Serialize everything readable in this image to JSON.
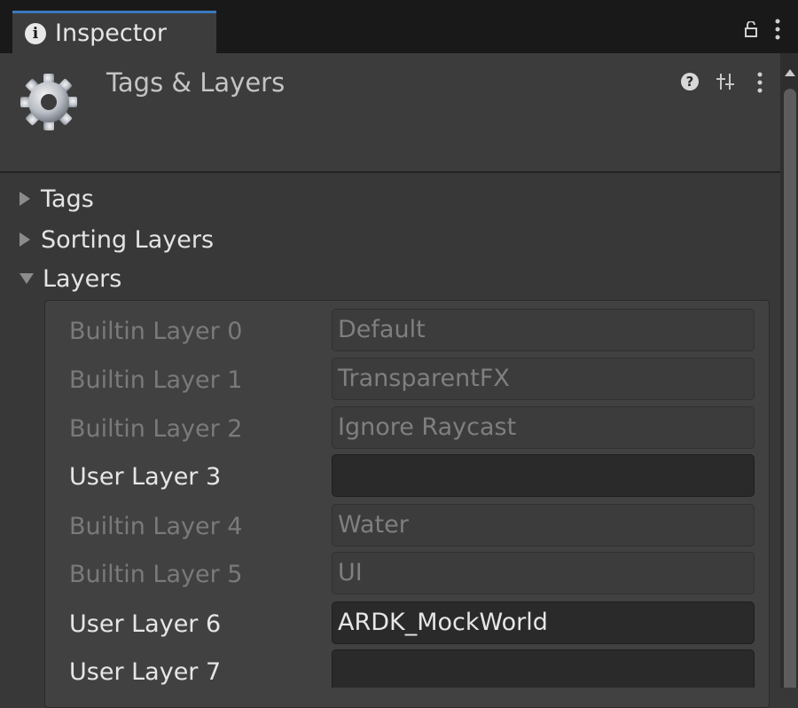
{
  "window": {
    "tab_title": "Inspector",
    "accent_color": "#3a79bb"
  },
  "header": {
    "title": "Tags & Layers",
    "icons": [
      "gear-icon",
      "help-icon",
      "presets-icon",
      "kebab-menu-icon"
    ]
  },
  "foldouts": {
    "tags": "Tags",
    "sorting_layers": "Sorting Layers",
    "layers": "Layers"
  },
  "layers": [
    {
      "label": "Builtin Layer 0",
      "value": "Default",
      "kind": "builtin"
    },
    {
      "label": "Builtin Layer 1",
      "value": "TransparentFX",
      "kind": "builtin"
    },
    {
      "label": "Builtin Layer 2",
      "value": "Ignore Raycast",
      "kind": "builtin"
    },
    {
      "label": "User Layer 3",
      "value": "",
      "kind": "user"
    },
    {
      "label": "Builtin Layer 4",
      "value": "Water",
      "kind": "builtin"
    },
    {
      "label": "Builtin Layer 5",
      "value": "UI",
      "kind": "builtin"
    },
    {
      "label": "User Layer 6",
      "value": "ARDK_MockWorld",
      "kind": "user"
    },
    {
      "label": "User Layer 7",
      "value": "",
      "kind": "user"
    }
  ]
}
